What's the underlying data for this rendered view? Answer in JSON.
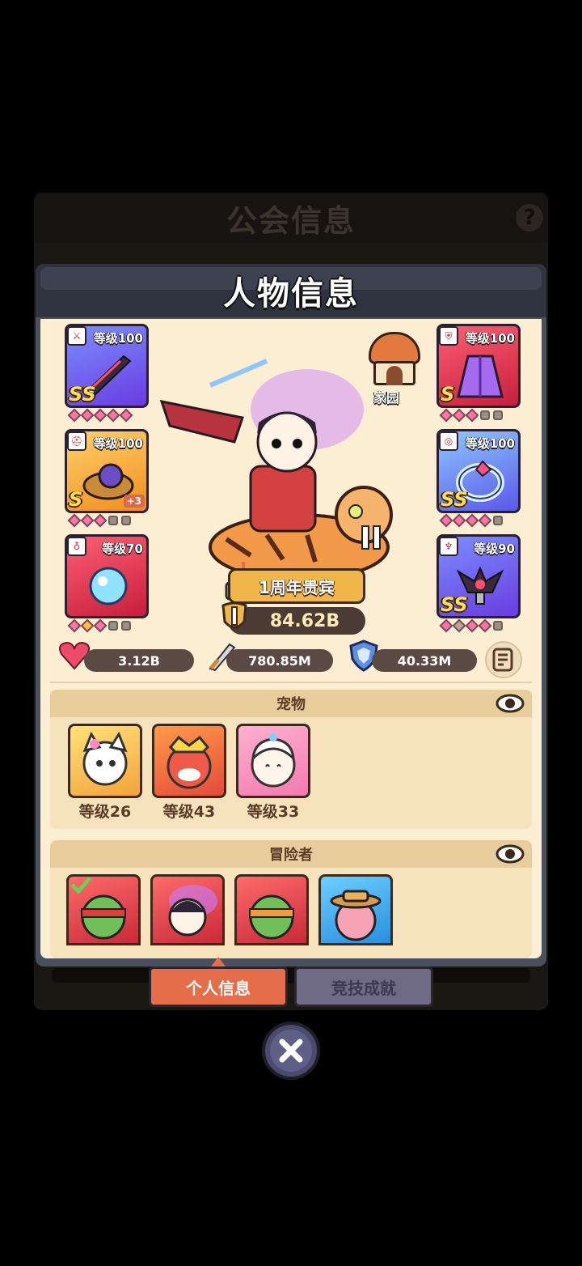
{
  "guild": {
    "title": "公会信息",
    "help_icon": "?"
  },
  "dialog": {
    "title": "人物信息"
  },
  "equipment_left": [
    {
      "level": "等级100",
      "grade": "SS",
      "tag_icon": "sword-icon",
      "gems": [
        "on",
        "on",
        "on",
        "on",
        "on"
      ],
      "plus": ""
    },
    {
      "level": "等级100",
      "grade": "S",
      "tag_icon": "helmet-icon",
      "gems": [
        "on",
        "on",
        "on",
        "lock",
        "lock"
      ],
      "plus": "+3"
    },
    {
      "level": "等级70",
      "grade": "",
      "tag_icon": "necklace-icon",
      "gems": [
        "on",
        "on",
        "on",
        "lock",
        "lock"
      ],
      "plus": ""
    }
  ],
  "equipment_right": [
    {
      "level": "等级100",
      "grade": "S",
      "tag_icon": "armor-icon",
      "gems": [
        "on",
        "on",
        "on",
        "lock",
        "lock"
      ],
      "plus": ""
    },
    {
      "level": "等级100",
      "grade": "SS",
      "tag_icon": "ring-icon",
      "gems": [
        "on",
        "on",
        "on",
        "on",
        "lock"
      ],
      "plus": ""
    },
    {
      "level": "等级90",
      "grade": "SS",
      "tag_icon": "amulet-icon",
      "gems": [
        "on",
        "off",
        "on",
        "on",
        "lock"
      ],
      "plus": ""
    }
  ],
  "home": {
    "label": "家园"
  },
  "hero": {
    "title_banner": "1周年贵宾",
    "power": "84.62B"
  },
  "stats": {
    "hp": "3.12B",
    "attack": "780.85M",
    "defense": "40.33M"
  },
  "pets": {
    "title": "宠物",
    "items": [
      {
        "level": "等级26"
      },
      {
        "level": "等级43"
      },
      {
        "level": "等级33"
      }
    ]
  },
  "adventurers": {
    "title": "冒险者",
    "count_visible": 4
  },
  "tabs": {
    "personal": "个人信息",
    "arena": "竞技成就"
  },
  "colors": {
    "accent": "#e56d4a",
    "panel": "#fbeed3",
    "gem": "#ff73a6"
  }
}
